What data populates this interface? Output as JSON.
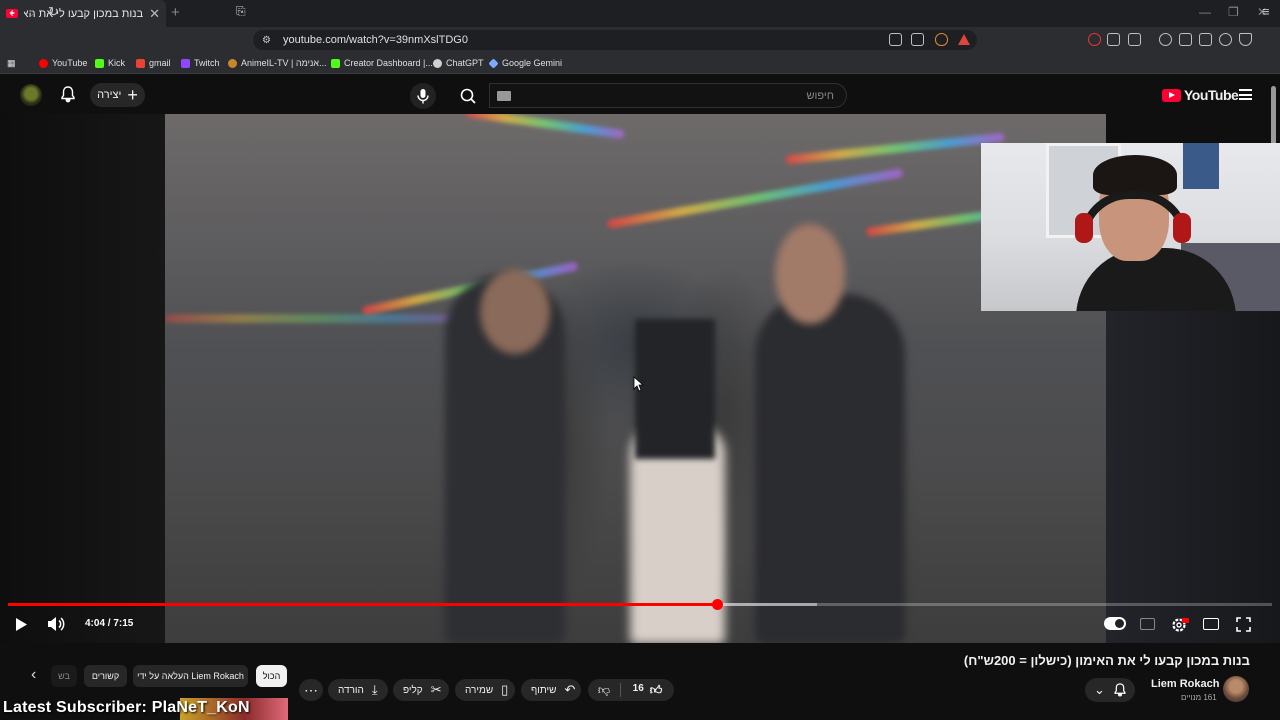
{
  "browser": {
    "tab_title": "בנות במכון קבעו לי את האימון (כ",
    "url": "youtube.com/watch?v=39nmXslTDG0",
    "bookmarks": [
      "YouTube",
      "Kick",
      "gmail",
      "Twitch",
      "AnimeIL-TV | אנימה...",
      "Creator Dashboard |...",
      "ChatGPT",
      "Google Gemini"
    ]
  },
  "header": {
    "create_label": "יצירה",
    "search_placeholder": "חיפוש",
    "logo_text": "YouTube"
  },
  "player": {
    "time": "4:04 / 7:15",
    "progress": 0.5611,
    "buffered": 0.64
  },
  "video": {
    "title": "בנות במכון קבעו לי את האימון (כישלון = 200ש\"ח)",
    "channel": "Liem Rokach",
    "subscribers": "161 מנויים",
    "likes": "16"
  },
  "actions": {
    "share": "שיתוף",
    "save": "שמירה",
    "clip": "קליפ",
    "download": "הורדה"
  },
  "chips": {
    "all": "הכול",
    "uploaded_by": "העלאה על ידי Liem Rokach",
    "related": "קשורים",
    "more": "בש"
  },
  "overlay": {
    "latest_subscriber": "Latest Subscriber: PlaNeT_KoN"
  },
  "colors": {
    "accent": "#ff0000",
    "background": "#0f0f0f",
    "chip": "#272727"
  }
}
